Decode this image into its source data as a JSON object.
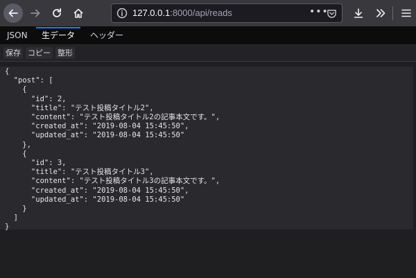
{
  "browser": {
    "url_host": "127.0.0.1",
    "url_rest": ":8000/api/reads",
    "dots": "•••"
  },
  "tabs": [
    {
      "label": "JSON"
    },
    {
      "label": "生データ"
    },
    {
      "label": "ヘッダー"
    }
  ],
  "raw_toolbar": {
    "save": "保存",
    "copy": "コピー",
    "pretty": "整形"
  },
  "raw_lines": [
    "{",
    "  \"post\": [",
    "    {",
    "      \"id\": 2,",
    "      \"title\": \"テスト投稿タイトル2\",",
    "      \"content\": \"テスト投稿タイトル2の記事本文です。\",",
    "      \"created_at\": \"2019-08-04 15:45:50\",",
    "      \"updated_at\": \"2019-08-04 15:45:50\"",
    "    },",
    "    {",
    "      \"id\": 3,",
    "      \"title\": \"テスト投稿タイトル3\",",
    "      \"content\": \"テスト投稿タイトル3の記事本文です。\",",
    "      \"created_at\": \"2019-08-04 15:45:50\",",
    "      \"updated_at\": \"2019-08-04 15:45:50\"",
    "    }",
    "  ]",
    "}"
  ],
  "colors": {
    "toolbar": "#38383d",
    "panel": "#2a2a2e",
    "accent": "#0a84ff"
  }
}
